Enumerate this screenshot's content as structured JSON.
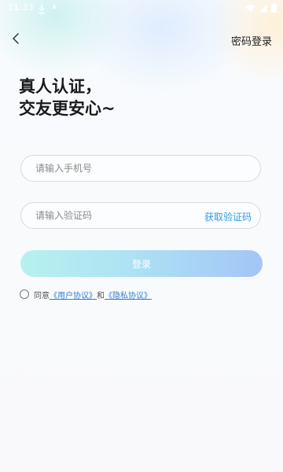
{
  "status_bar": {
    "time": "11:33",
    "colors": {
      "text": "#ffffff"
    },
    "icons": [
      "download-icon",
      "dot-icon",
      "wifi-icon",
      "signal-icon",
      "battery-icon"
    ]
  },
  "header": {
    "back_icon": "chevron-left-icon",
    "password_login_label": "密码登录"
  },
  "title": {
    "line1": "真人认证，",
    "line2": "交友更安心~"
  },
  "form": {
    "phone": {
      "value": "",
      "placeholder": "请输入手机号"
    },
    "code": {
      "value": "",
      "placeholder": "请输入验证码"
    },
    "get_code_label": "获取验证码",
    "login_label": "登录"
  },
  "agreement": {
    "checked": false,
    "prefix": "同意",
    "user_agreement": "《用户协议》",
    "conjunction": "和",
    "privacy_agreement": "《隐私协议》"
  },
  "colors": {
    "accent_link": "#2f9be0",
    "agreement_link": "#2f7fd6",
    "button_gradient_start": "#b7f1ee",
    "button_gradient_end": "#a3c5f6"
  }
}
